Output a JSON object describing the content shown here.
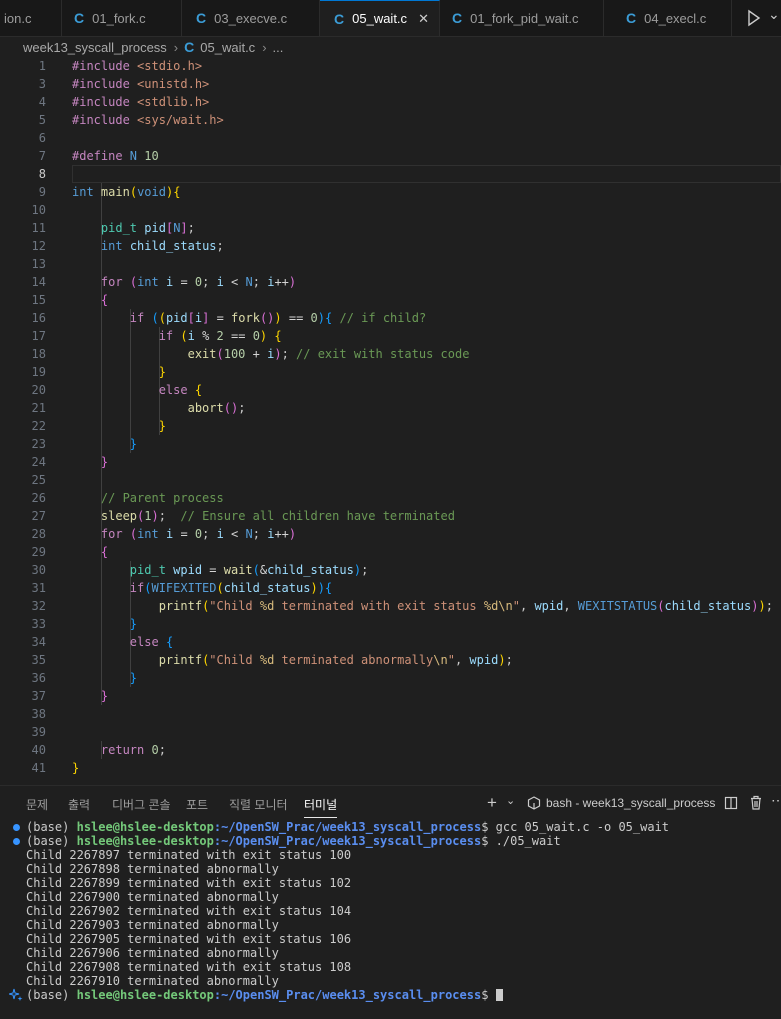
{
  "tabs": [
    {
      "label": "ion.c",
      "icon": false,
      "active": false
    },
    {
      "label": "01_fork.c",
      "icon": true,
      "active": false
    },
    {
      "label": "03_execve.c",
      "icon": true,
      "active": false
    },
    {
      "label": "05_wait.c",
      "icon": true,
      "active": true
    },
    {
      "label": "01_fork_pid_wait.c",
      "icon": true,
      "active": false
    },
    {
      "label": "04_execl.c",
      "icon": true,
      "active": false
    }
  ],
  "breadcrumb": {
    "folder": "week13_syscall_process",
    "file": "05_wait.c",
    "more": "..."
  },
  "editor": {
    "current_line": 8,
    "lines": [
      {
        "n": "1",
        "t": [
          [
            "dir",
            "#include "
          ],
          [
            "str",
            "<stdio.h>"
          ]
        ]
      },
      {
        "n": "3",
        "t": [
          [
            "dir",
            "#include "
          ],
          [
            "str",
            "<unistd.h>"
          ]
        ]
      },
      {
        "n": "4",
        "t": [
          [
            "dir",
            "#include "
          ],
          [
            "str",
            "<stdlib.h>"
          ]
        ]
      },
      {
        "n": "5",
        "t": [
          [
            "dir",
            "#include "
          ],
          [
            "str",
            "<sys/wait.h>"
          ]
        ]
      },
      {
        "n": "6",
        "t": []
      },
      {
        "n": "7",
        "t": [
          [
            "dir",
            "#define "
          ],
          [
            "mac",
            "N"
          ],
          [
            "plain",
            " "
          ],
          [
            "num",
            "10"
          ]
        ]
      },
      {
        "n": "8",
        "t": []
      },
      {
        "n": "9",
        "t": [
          [
            "kw",
            "int"
          ],
          [
            "plain",
            " "
          ],
          [
            "fn",
            "main"
          ],
          [
            "b1",
            "("
          ],
          [
            "kw",
            "void"
          ],
          [
            "b1",
            ")"
          ],
          [
            "b1",
            "{"
          ]
        ]
      },
      {
        "n": "10",
        "t": []
      },
      {
        "n": "11",
        "t": [
          [
            "plain",
            "    "
          ],
          [
            "type",
            "pid_t"
          ],
          [
            "plain",
            " "
          ],
          [
            "var",
            "pid"
          ],
          [
            "b2",
            "["
          ],
          [
            "mac",
            "N"
          ],
          [
            "b2",
            "]"
          ],
          [
            "plain",
            ";"
          ]
        ]
      },
      {
        "n": "12",
        "t": [
          [
            "plain",
            "    "
          ],
          [
            "kw",
            "int"
          ],
          [
            "plain",
            " "
          ],
          [
            "var",
            "child_status"
          ],
          [
            "plain",
            ";"
          ]
        ]
      },
      {
        "n": "13",
        "t": []
      },
      {
        "n": "14",
        "t": [
          [
            "plain",
            "    "
          ],
          [
            "ctl",
            "for"
          ],
          [
            "plain",
            " "
          ],
          [
            "b2",
            "("
          ],
          [
            "kw",
            "int"
          ],
          [
            "plain",
            " "
          ],
          [
            "var",
            "i"
          ],
          [
            "op",
            " = "
          ],
          [
            "num",
            "0"
          ],
          [
            "plain",
            "; "
          ],
          [
            "var",
            "i"
          ],
          [
            "op",
            " < "
          ],
          [
            "mac",
            "N"
          ],
          [
            "plain",
            "; "
          ],
          [
            "var",
            "i"
          ],
          [
            "op",
            "++"
          ],
          [
            "b2",
            ")"
          ]
        ]
      },
      {
        "n": "15",
        "t": [
          [
            "plain",
            "    "
          ],
          [
            "b2",
            "{"
          ]
        ]
      },
      {
        "n": "16",
        "t": [
          [
            "plain",
            "        "
          ],
          [
            "ctl",
            "if"
          ],
          [
            "plain",
            " "
          ],
          [
            "b3",
            "("
          ],
          [
            "b1",
            "("
          ],
          [
            "var",
            "pid"
          ],
          [
            "b2",
            "["
          ],
          [
            "var",
            "i"
          ],
          [
            "b2",
            "]"
          ],
          [
            "op",
            " = "
          ],
          [
            "fn",
            "fork"
          ],
          [
            "b2",
            "("
          ],
          [
            "b2",
            ")"
          ],
          [
            "b1",
            ")"
          ],
          [
            "op",
            " == "
          ],
          [
            "num",
            "0"
          ],
          [
            "b3",
            ")"
          ],
          [
            "b3",
            "{"
          ],
          [
            "plain",
            " "
          ],
          [
            "com",
            "// if child?"
          ]
        ]
      },
      {
        "n": "17",
        "t": [
          [
            "plain",
            "            "
          ],
          [
            "ctl",
            "if"
          ],
          [
            "plain",
            " "
          ],
          [
            "b1",
            "("
          ],
          [
            "var",
            "i"
          ],
          [
            "op",
            " % "
          ],
          [
            "num",
            "2"
          ],
          [
            "op",
            " == "
          ],
          [
            "num",
            "0"
          ],
          [
            "b1",
            ")"
          ],
          [
            "plain",
            " "
          ],
          [
            "b1",
            "{"
          ]
        ]
      },
      {
        "n": "18",
        "t": [
          [
            "plain",
            "                "
          ],
          [
            "fn",
            "exit"
          ],
          [
            "b2",
            "("
          ],
          [
            "num",
            "100"
          ],
          [
            "op",
            " + "
          ],
          [
            "var",
            "i"
          ],
          [
            "b2",
            ")"
          ],
          [
            "plain",
            "; "
          ],
          [
            "com",
            "// exit with status code"
          ]
        ]
      },
      {
        "n": "19",
        "t": [
          [
            "plain",
            "            "
          ],
          [
            "b1",
            "}"
          ]
        ]
      },
      {
        "n": "20",
        "t": [
          [
            "plain",
            "            "
          ],
          [
            "ctl",
            "else"
          ],
          [
            "plain",
            " "
          ],
          [
            "b1",
            "{"
          ]
        ]
      },
      {
        "n": "21",
        "t": [
          [
            "plain",
            "                "
          ],
          [
            "fn",
            "abort"
          ],
          [
            "b2",
            "("
          ],
          [
            "b2",
            ")"
          ],
          [
            "plain",
            ";"
          ]
        ]
      },
      {
        "n": "22",
        "t": [
          [
            "plain",
            "            "
          ],
          [
            "b1",
            "}"
          ]
        ]
      },
      {
        "n": "23",
        "t": [
          [
            "plain",
            "        "
          ],
          [
            "b3",
            "}"
          ]
        ]
      },
      {
        "n": "24",
        "t": [
          [
            "plain",
            "    "
          ],
          [
            "b2",
            "}"
          ]
        ]
      },
      {
        "n": "25",
        "t": []
      },
      {
        "n": "26",
        "t": [
          [
            "plain",
            "    "
          ],
          [
            "com",
            "// Parent process"
          ]
        ]
      },
      {
        "n": "27",
        "t": [
          [
            "plain",
            "    "
          ],
          [
            "fn",
            "sleep"
          ],
          [
            "b2",
            "("
          ],
          [
            "num",
            "1"
          ],
          [
            "b2",
            ")"
          ],
          [
            "plain",
            ";  "
          ],
          [
            "com",
            "// Ensure all children have terminated"
          ]
        ]
      },
      {
        "n": "28",
        "t": [
          [
            "plain",
            "    "
          ],
          [
            "ctl",
            "for"
          ],
          [
            "plain",
            " "
          ],
          [
            "b2",
            "("
          ],
          [
            "kw",
            "int"
          ],
          [
            "plain",
            " "
          ],
          [
            "var",
            "i"
          ],
          [
            "op",
            " = "
          ],
          [
            "num",
            "0"
          ],
          [
            "plain",
            "; "
          ],
          [
            "var",
            "i"
          ],
          [
            "op",
            " < "
          ],
          [
            "mac",
            "N"
          ],
          [
            "plain",
            "; "
          ],
          [
            "var",
            "i"
          ],
          [
            "op",
            "++"
          ],
          [
            "b2",
            ")"
          ]
        ]
      },
      {
        "n": "29",
        "t": [
          [
            "plain",
            "    "
          ],
          [
            "b2",
            "{"
          ]
        ]
      },
      {
        "n": "30",
        "t": [
          [
            "plain",
            "        "
          ],
          [
            "type",
            "pid_t"
          ],
          [
            "plain",
            " "
          ],
          [
            "var",
            "wpid"
          ],
          [
            "op",
            " = "
          ],
          [
            "fn",
            "wait"
          ],
          [
            "b3",
            "("
          ],
          [
            "op",
            "&"
          ],
          [
            "var",
            "child_status"
          ],
          [
            "b3",
            ")"
          ],
          [
            "plain",
            ";"
          ]
        ]
      },
      {
        "n": "31",
        "t": [
          [
            "plain",
            "        "
          ],
          [
            "ctl",
            "if"
          ],
          [
            "b3",
            "("
          ],
          [
            "macfn",
            "WIFEXITED"
          ],
          [
            "b1",
            "("
          ],
          [
            "var",
            "child_status"
          ],
          [
            "b1",
            ")"
          ],
          [
            "b3",
            ")"
          ],
          [
            "b3",
            "{"
          ]
        ]
      },
      {
        "n": "32",
        "t": [
          [
            "plain",
            "            "
          ],
          [
            "fn",
            "printf"
          ],
          [
            "b1",
            "("
          ],
          [
            "str",
            "\"Child "
          ],
          [
            "esc",
            "%d"
          ],
          [
            "str",
            " terminated with exit status "
          ],
          [
            "esc",
            "%d\\n"
          ],
          [
            "str",
            "\""
          ],
          [
            "plain",
            ", "
          ],
          [
            "var",
            "wpid"
          ],
          [
            "plain",
            ", "
          ],
          [
            "macfn",
            "WEXITSTATUS"
          ],
          [
            "b2",
            "("
          ],
          [
            "var",
            "child_status"
          ],
          [
            "b2",
            ")"
          ],
          [
            "b1",
            ")"
          ],
          [
            "plain",
            ";"
          ]
        ]
      },
      {
        "n": "33",
        "t": [
          [
            "plain",
            "        "
          ],
          [
            "b3",
            "}"
          ]
        ]
      },
      {
        "n": "34",
        "t": [
          [
            "plain",
            "        "
          ],
          [
            "ctl",
            "else"
          ],
          [
            "plain",
            " "
          ],
          [
            "b3",
            "{"
          ]
        ]
      },
      {
        "n": "35",
        "t": [
          [
            "plain",
            "            "
          ],
          [
            "fn",
            "printf"
          ],
          [
            "b1",
            "("
          ],
          [
            "str",
            "\"Child "
          ],
          [
            "esc",
            "%d"
          ],
          [
            "str",
            " terminated abnormally"
          ],
          [
            "esc",
            "\\n"
          ],
          [
            "str",
            "\""
          ],
          [
            "plain",
            ", "
          ],
          [
            "var",
            "wpid"
          ],
          [
            "b1",
            ")"
          ],
          [
            "plain",
            ";"
          ]
        ]
      },
      {
        "n": "36",
        "t": [
          [
            "plain",
            "        "
          ],
          [
            "b3",
            "}"
          ]
        ]
      },
      {
        "n": "37",
        "t": [
          [
            "plain",
            "    "
          ],
          [
            "b2",
            "}"
          ]
        ]
      },
      {
        "n": "38",
        "t": []
      },
      {
        "n": "39",
        "t": []
      },
      {
        "n": "40",
        "t": [
          [
            "plain",
            "    "
          ],
          [
            "ctl",
            "return"
          ],
          [
            "plain",
            " "
          ],
          [
            "num",
            "0"
          ],
          [
            "plain",
            ";"
          ]
        ]
      },
      {
        "n": "41",
        "t": [
          [
            "b1",
            "}"
          ]
        ]
      }
    ]
  },
  "panel": {
    "tabs": [
      "문제",
      "출력",
      "디버그 콘솔",
      "포트",
      "직렬 모니터",
      "터미널"
    ],
    "active_tab": "터미널",
    "terminal_name": "bash - week13_syscall_process"
  },
  "terminal": {
    "prompt_env": "(base)",
    "user_host": "hslee@hslee-desktop",
    "path": ":~/OpenSW_Prac/week13_syscall_process",
    "commands": [
      "gcc 05_wait.c -o 05_wait",
      "./05_wait"
    ],
    "output": [
      "Child 2267897 terminated with exit status 100",
      "Child 2267898 terminated abnormally",
      "Child 2267899 terminated with exit status 102",
      "Child 2267900 terminated abnormally",
      "Child 2267902 terminated with exit status 104",
      "Child 2267903 terminated abnormally",
      "Child 2267905 terminated with exit status 106",
      "Child 2267906 terminated abnormally",
      "Child 2267908 terminated with exit status 108",
      "Child 2267910 terminated abnormally"
    ]
  },
  "colors": {
    "accent": "#0078d4",
    "background": "#1f1f1f",
    "c_icon": "#3b9cd6"
  }
}
